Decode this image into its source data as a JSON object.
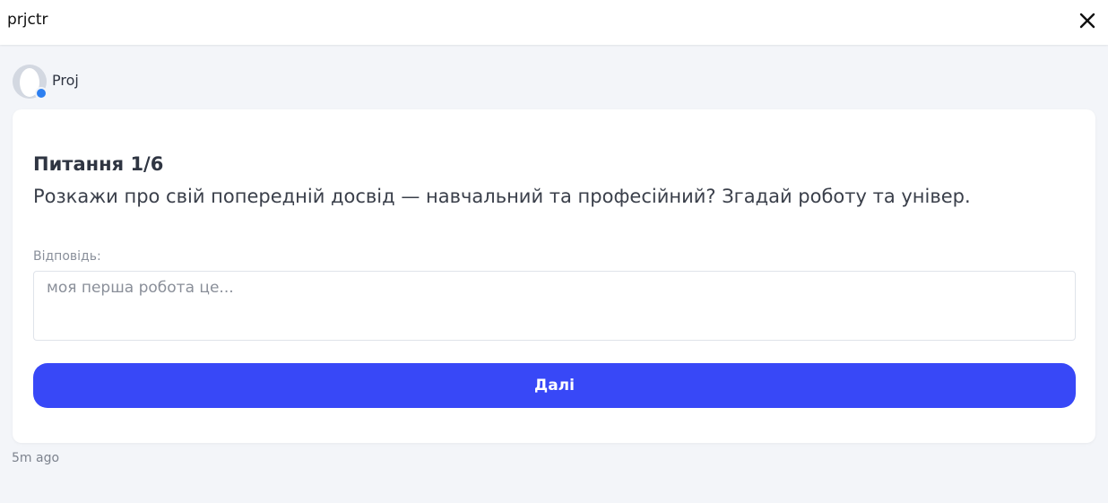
{
  "header": {
    "app_title": "prjctr",
    "close_icon": "close-icon"
  },
  "message": {
    "sender_name": "Proj",
    "avatar_icon": "user-avatar-icon",
    "status_color": "#2d7ff0",
    "timestamp": "5m ago"
  },
  "question": {
    "number": "Питання 1/6",
    "text": "Розкажи про свій попередній досвід — навчальний та професійний? Згадай роботу та універ.",
    "answer_label": "Відповідь:",
    "answer_placeholder": "моя перша робота це...",
    "answer_value": "",
    "next_label": "Далі"
  },
  "colors": {
    "accent": "#3848f7",
    "background": "#f3f5f9"
  }
}
